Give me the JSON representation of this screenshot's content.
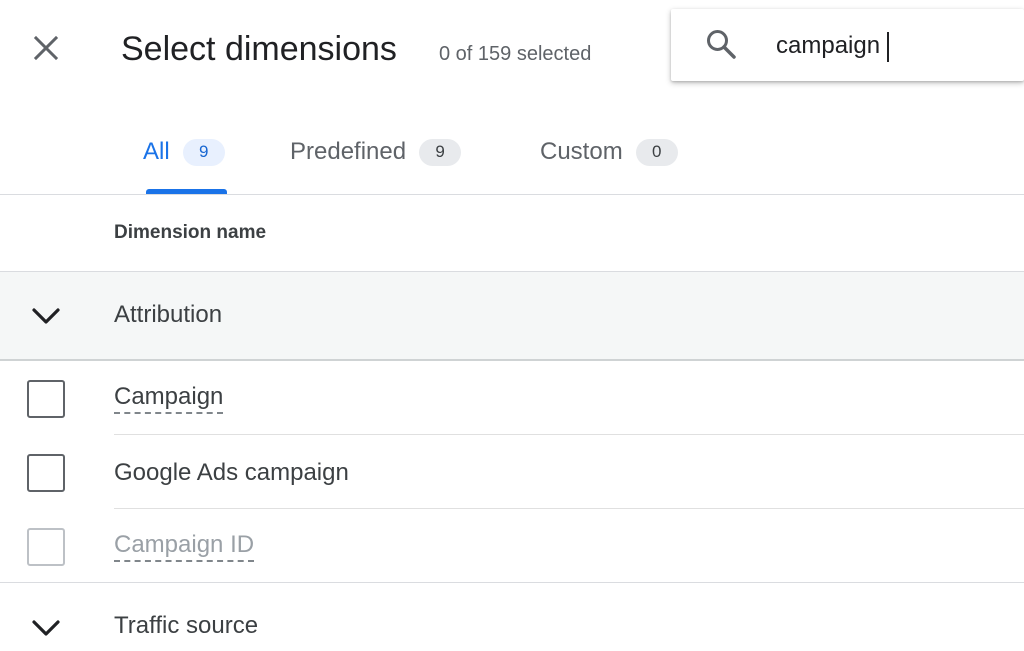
{
  "header": {
    "title": "Select dimensions",
    "selection_count": "0 of 159 selected"
  },
  "search": {
    "value": "campaign",
    "icon": "search-icon"
  },
  "tabs": [
    {
      "label": "All",
      "count": "9",
      "active": true
    },
    {
      "label": "Predefined",
      "count": "9",
      "active": false
    },
    {
      "label": "Custom",
      "count": "0",
      "active": false
    }
  ],
  "table": {
    "column_header": "Dimension name"
  },
  "groups": [
    {
      "label": "Attribution",
      "expanded": true,
      "items": [
        {
          "label": "Campaign",
          "checked": false,
          "disabled": false
        },
        {
          "label": "Google Ads campaign",
          "checked": false,
          "disabled": false
        },
        {
          "label": "Campaign ID",
          "checked": false,
          "disabled": true
        }
      ]
    },
    {
      "label": "Traffic source",
      "expanded": true
    }
  ],
  "colors": {
    "accent": "#1a73e8",
    "text_primary": "#202124",
    "text_secondary": "#5f6368",
    "disabled": "#9aa0a6",
    "group_bg": "#f5f7f7"
  }
}
